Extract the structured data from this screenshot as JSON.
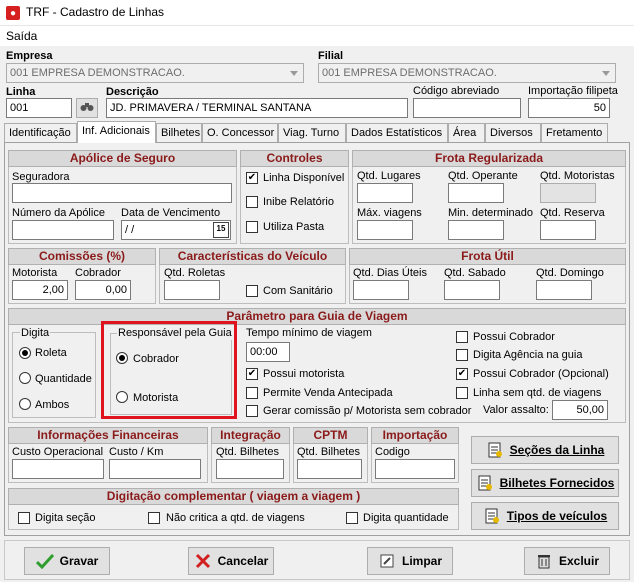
{
  "window": {
    "title": "TRF - Cadastro de Linhas"
  },
  "menu": {
    "saida": "Saída"
  },
  "header": {
    "empresa_label": "Empresa",
    "empresa_value": "001 EMPRESA DEMONSTRACAO.",
    "filial_label": "Filial",
    "filial_value": "001 EMPRESA DEMONSTRACAO.",
    "linha_label": "Linha",
    "linha_value": "001",
    "descricao_label": "Descrição",
    "descricao_value": "JD. PRIMAVERA / TERMINAL SANTANA",
    "codigo_abreviado_label": "Código abreviado",
    "codigo_abreviado_value": "",
    "importacao_filipeta_label": "Importação filipeta",
    "importacao_filipeta_value": "50"
  },
  "tabs": [
    "Identificação",
    "Inf. Adicionais",
    "Bilhetes",
    "O. Concessor",
    "Viag. Turno",
    "Dados Estatísticos",
    "Área",
    "Diversos",
    "Fretamento"
  ],
  "apolice": {
    "title": "Apólice de Seguro",
    "seguradora_label": "Seguradora",
    "seguradora_value": "",
    "numero_label": "Número da Apólice",
    "numero_value": "",
    "vencimento_label": "Data de Vencimento",
    "vencimento_value": " / /",
    "calendar_value": "15"
  },
  "controles": {
    "title": "Controles",
    "linha_disponivel": "Linha Disponível",
    "inibe_relatorio": "Inibe Relatório",
    "utiliza_pasta": "Utiliza Pasta",
    "linha_disponivel_checked": true,
    "inibe_relatorio_checked": false,
    "utiliza_pasta_checked": false
  },
  "frota_regularizada": {
    "title": "Frota Regularizada",
    "qtd_lugares": "Qtd. Lugares",
    "qtd_operante": "Qtd. Operante",
    "qtd_motoristas": "Qtd. Motoristas",
    "max_viagens": "Máx. viagens",
    "min_determinado": "Min. determinado",
    "qtd_reserva": "Qtd. Reserva"
  },
  "comissoes": {
    "title": "Comissões (%)",
    "motorista_label": "Motorista",
    "motorista_value": "2,00",
    "cobrador_label": "Cobrador",
    "cobrador_value": "0,00"
  },
  "caracteristicas": {
    "title": "Características do Veículo",
    "qtd_roletas": "Qtd. Roletas",
    "com_sanitario": "Com Sanitário",
    "com_sanitario_checked": false
  },
  "frota_util": {
    "title": "Frota Útil",
    "qtd_dias_uteis": "Qtd. Dias Úteis",
    "qtd_sabado": "Qtd. Sabado",
    "qtd_domingo": "Qtd. Domingo"
  },
  "guia": {
    "title": "Parâmetro para Guia de Viagem",
    "digita_label": "Digita",
    "digita_options": [
      "Roleta",
      "Quantidade",
      "Ambos"
    ],
    "digita_selected": "Roleta",
    "responsavel_label": "Responsável pela Guia",
    "responsavel_options": [
      "Cobrador",
      "Motorista"
    ],
    "responsavel_selected": "Cobrador",
    "tempo_label": "Tempo mínimo de viagem",
    "tempo_value": "00:00",
    "possui_motorista": "Possui motorista",
    "possui_motorista_checked": true,
    "permite_venda": "Permite Venda Antecipada",
    "permite_venda_checked": false,
    "gerar_comissao": "Gerar comissão p/ Motorista sem cobrador",
    "gerar_comissao_checked": false,
    "possui_cobrador": "Possui Cobrador",
    "possui_cobrador_checked": false,
    "digita_agencia": "Digita Agência na guia",
    "digita_agencia_checked": false,
    "possui_cobrador_opcional": "Possui Cobrador (Opcional)",
    "possui_cobrador_opcional_checked": true,
    "linha_sem_qtd": "Linha sem  qtd. de viagens",
    "linha_sem_qtd_checked": false,
    "valor_assalto_label": "Valor assalto:",
    "valor_assalto_value": "50,00"
  },
  "financeiras": {
    "title": "Informações Financeiras",
    "custo_operacional": "Custo Operacional",
    "custo_km": "Custo / Km"
  },
  "integracao": {
    "title": "Integração",
    "qtd_bilhetes": "Qtd. Bilhetes"
  },
  "cptm": {
    "title": "CPTM",
    "qtd_bilhetes": "Qtd. Bilhetes"
  },
  "importacao": {
    "title": "Importação",
    "codigo": "Codigo"
  },
  "digitacao": {
    "title": "Digitação complementar ( viagem a viagem )",
    "digita_secao": "Digita seção",
    "nao_critica": "Não critica a qtd. de  viagens",
    "digita_quantidade": "Digita quantidade"
  },
  "side_buttons": {
    "secoes": "Seções da Linha",
    "bilhetes": "Bilhetes Fornecidos",
    "tipos": "Tipos de veículos"
  },
  "footer": {
    "gravar": "Gravar",
    "cancelar": "Cancelar",
    "limpar": "Limpar",
    "excluir": "Excluir"
  },
  "colors": {
    "header_text": "#8b1a1a",
    "highlight": "#e0141e",
    "check_green": "#2e9e2e",
    "cancel_red": "#d21f1f"
  }
}
